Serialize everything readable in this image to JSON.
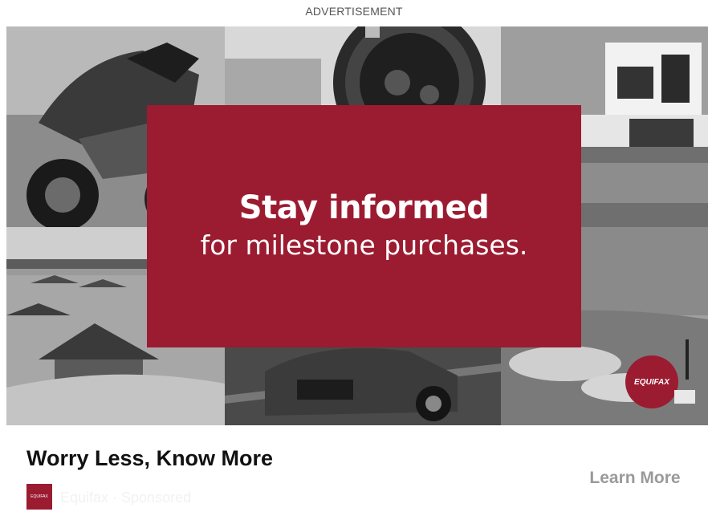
{
  "ad_label": "ADVERTISEMENT",
  "creative": {
    "headline": "Stay informed",
    "subheadline": "for milestone purchases.",
    "brand_badge": "EQUIFAX",
    "box_color": "#9b1b30",
    "tiles": [
      "motorcycle-photo",
      "watch-photo",
      "modern-house-photo",
      "overwater-bungalows-photo",
      "sports-car-photo",
      "golf-course-photo"
    ]
  },
  "footer": {
    "title": "Worry Less, Know More",
    "sponsor_logo_text": "EQUIFAX",
    "sponsor_text": "Equifax · Sponsored",
    "cta_label": "Learn More"
  }
}
